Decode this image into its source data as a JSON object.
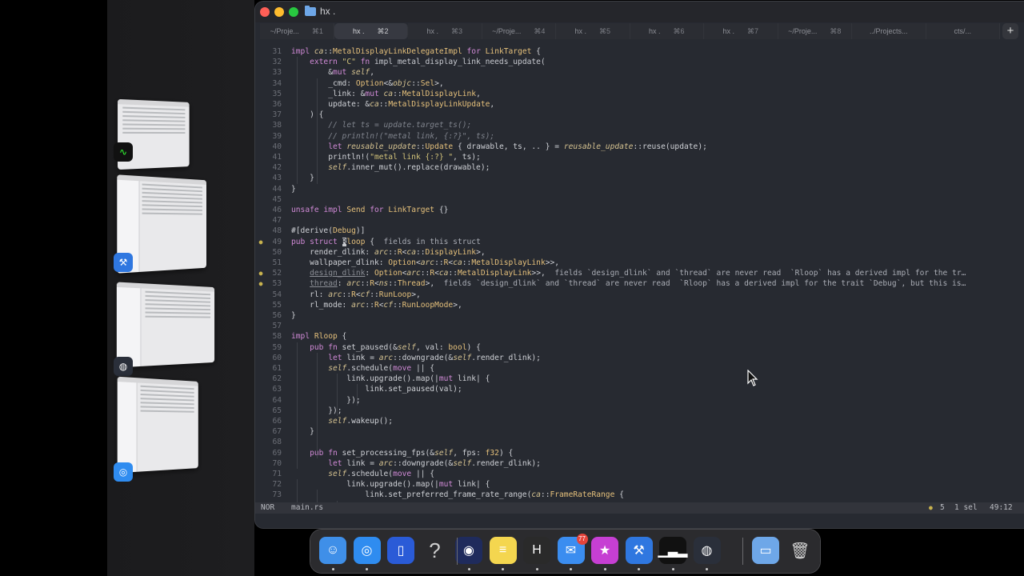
{
  "window": {
    "title": "hx ."
  },
  "tabs": [
    {
      "label": "~/Proje...",
      "shortcut": "⌘1"
    },
    {
      "label": "hx .",
      "shortcut": "⌘2",
      "active": true
    },
    {
      "label": "hx .",
      "shortcut": "⌘3"
    },
    {
      "label": "~/Proje...",
      "shortcut": "⌘4"
    },
    {
      "label": "hx .",
      "shortcut": "⌘5"
    },
    {
      "label": "hx .",
      "shortcut": "⌘6"
    },
    {
      "label": "hx .",
      "shortcut": "⌘7"
    },
    {
      "label": "~/Proje...",
      "shortcut": "⌘8"
    },
    {
      "label": "../Projects...",
      "shortcut": ""
    },
    {
      "label": "cts/...",
      "shortcut": ""
    }
  ],
  "new_tab_label": "+",
  "editor": {
    "lines": [
      {
        "n": "31",
        "parts": [
          [
            "kw",
            "impl "
          ],
          [
            "ns",
            "ca"
          ],
          [
            "",
            "::"
          ],
          [
            "ty",
            "MetalDisplayLinkDelegateImpl"
          ],
          [
            "kw",
            " for "
          ],
          [
            "ty",
            "LinkTarget"
          ],
          [
            "",
            " {"
          ]
        ]
      },
      {
        "n": "32",
        "parts": [
          [
            "",
            "    "
          ],
          [
            "kw",
            "extern "
          ],
          [
            "str",
            "\"C\" "
          ],
          [
            "kw",
            "fn "
          ],
          [
            "fn",
            "impl_metal_display_link_needs_update("
          ]
        ]
      },
      {
        "n": "33",
        "parts": [
          [
            "",
            "        &"
          ],
          [
            "kw",
            "mut "
          ],
          [
            "ns",
            "self"
          ],
          [
            "",
            ","
          ]
        ]
      },
      {
        "n": "34",
        "parts": [
          [
            "",
            "        _cmd: "
          ],
          [
            "ty",
            "Option"
          ],
          [
            "",
            "<&"
          ],
          [
            "ns",
            "objc"
          ],
          [
            "",
            "::"
          ],
          [
            "ty",
            "Sel"
          ],
          [
            "",
            ">,"
          ]
        ]
      },
      {
        "n": "35",
        "parts": [
          [
            "",
            "        _link: &"
          ],
          [
            "kw",
            "mut "
          ],
          [
            "ns",
            "ca"
          ],
          [
            "",
            "::"
          ],
          [
            "ty",
            "MetalDisplayLink"
          ],
          [
            "",
            ","
          ]
        ]
      },
      {
        "n": "36",
        "parts": [
          [
            "",
            "        update: &"
          ],
          [
            "ns",
            "ca"
          ],
          [
            "",
            "::"
          ],
          [
            "ty",
            "MetalDisplayLinkUpdate"
          ],
          [
            "",
            ","
          ]
        ]
      },
      {
        "n": "37",
        "parts": [
          [
            "",
            "    ) {"
          ]
        ]
      },
      {
        "n": "38",
        "parts": [
          [
            "",
            "        "
          ],
          [
            "cm",
            "// let ts = update.target_ts();"
          ]
        ]
      },
      {
        "n": "39",
        "parts": [
          [
            "",
            "        "
          ],
          [
            "cm",
            "// println!(\"metal link, {:?}\", ts);"
          ]
        ]
      },
      {
        "n": "40",
        "parts": [
          [
            "",
            "        "
          ],
          [
            "kw",
            "let "
          ],
          [
            "ns",
            "reusable_update"
          ],
          [
            "",
            "::"
          ],
          [
            "ty",
            "Update"
          ],
          [
            "",
            " { drawable, ts, .. } = "
          ],
          [
            "ns",
            "reusable_update"
          ],
          [
            "",
            "::reuse(update);"
          ]
        ]
      },
      {
        "n": "41",
        "parts": [
          [
            "",
            "        println!("
          ],
          [
            "str",
            "\"metal link {:?} \""
          ],
          [
            "",
            ", ts);"
          ]
        ]
      },
      {
        "n": "42",
        "parts": [
          [
            "",
            "        "
          ],
          [
            "ns",
            "self"
          ],
          [
            "",
            ".inner_mut().replace(drawable);"
          ]
        ]
      },
      {
        "n": "43",
        "parts": [
          [
            "",
            "    }"
          ]
        ]
      },
      {
        "n": "44",
        "parts": [
          [
            "",
            "}"
          ]
        ]
      },
      {
        "n": "45",
        "parts": [
          [
            "",
            ""
          ]
        ]
      },
      {
        "n": "46",
        "parts": [
          [
            "kw",
            "unsafe impl "
          ],
          [
            "ty",
            "Send"
          ],
          [
            "kw",
            " for "
          ],
          [
            "ty",
            "LinkTarget"
          ],
          [
            "",
            " {}"
          ]
        ]
      },
      {
        "n": "47",
        "parts": [
          [
            "",
            ""
          ]
        ]
      },
      {
        "n": "48",
        "parts": [
          [
            "",
            "#[derive("
          ],
          [
            "ty",
            "Debug"
          ],
          [
            "",
            ")]"
          ]
        ]
      },
      {
        "n": "49",
        "gutter": "●",
        "parts": [
          [
            "kw",
            "pub struct "
          ],
          [
            "cur",
            "R"
          ],
          [
            "ty",
            "loop"
          ],
          [
            "",
            " {  "
          ],
          [
            "hint",
            "fields in this struct"
          ]
        ]
      },
      {
        "n": "50",
        "parts": [
          [
            "",
            "    render_dlink: "
          ],
          [
            "ns",
            "arc"
          ],
          [
            "",
            "::"
          ],
          [
            "ty",
            "R"
          ],
          [
            "",
            "<"
          ],
          [
            "ns",
            "ca"
          ],
          [
            "",
            "::"
          ],
          [
            "ty",
            "DisplayLink"
          ],
          [
            "",
            ">,"
          ]
        ]
      },
      {
        "n": "51",
        "parts": [
          [
            "",
            "    wallpaper_dlink: "
          ],
          [
            "ty",
            "Option"
          ],
          [
            "",
            "<"
          ],
          [
            "ns",
            "arc"
          ],
          [
            "",
            "::"
          ],
          [
            "ty",
            "R"
          ],
          [
            "",
            "<"
          ],
          [
            "ns",
            "ca"
          ],
          [
            "",
            "::"
          ],
          [
            "ty",
            "MetalDisplayLink"
          ],
          [
            "",
            ">>,"
          ]
        ]
      },
      {
        "n": "52",
        "gutter": "●",
        "parts": [
          [
            "",
            "    "
          ],
          [
            "dim",
            "design_dlink"
          ],
          [
            "",
            ": "
          ],
          [
            "ty",
            "Option"
          ],
          [
            "",
            "<"
          ],
          [
            "ns",
            "arc"
          ],
          [
            "",
            "::"
          ],
          [
            "ty",
            "R"
          ],
          [
            "",
            "<"
          ],
          [
            "ns",
            "ca"
          ],
          [
            "",
            "::"
          ],
          [
            "ty",
            "MetalDisplayLink"
          ],
          [
            "",
            ">>,  "
          ],
          [
            "hint",
            "fields `design_dlink` and `thread` are never read  `Rloop` has a derived impl for the tr…"
          ]
        ]
      },
      {
        "n": "53",
        "gutter": "●",
        "parts": [
          [
            "",
            "    "
          ],
          [
            "dim",
            "thread"
          ],
          [
            "",
            ": "
          ],
          [
            "ns",
            "arc"
          ],
          [
            "",
            "::"
          ],
          [
            "ty",
            "R"
          ],
          [
            "",
            "<"
          ],
          [
            "ns",
            "ns"
          ],
          [
            "",
            "::"
          ],
          [
            "ty",
            "Thread"
          ],
          [
            "",
            ">,  "
          ],
          [
            "hint",
            "fields `design_dlink` and `thread` are never read  `Rloop` has a derived impl for the trait `Debug`, but this is…"
          ]
        ]
      },
      {
        "n": "54",
        "parts": [
          [
            "",
            "    rl: "
          ],
          [
            "ns",
            "arc"
          ],
          [
            "",
            "::"
          ],
          [
            "ty",
            "R"
          ],
          [
            "",
            "<"
          ],
          [
            "ns",
            "cf"
          ],
          [
            "",
            "::"
          ],
          [
            "ty",
            "RunLoop"
          ],
          [
            "",
            ">,"
          ]
        ]
      },
      {
        "n": "55",
        "parts": [
          [
            "",
            "    rl_mode: "
          ],
          [
            "ns",
            "arc"
          ],
          [
            "",
            "::"
          ],
          [
            "ty",
            "R"
          ],
          [
            "",
            "<"
          ],
          [
            "ns",
            "cf"
          ],
          [
            "",
            "::"
          ],
          [
            "ty",
            "RunLoopMode"
          ],
          [
            "",
            ">,"
          ]
        ]
      },
      {
        "n": "56",
        "parts": [
          [
            "",
            "}"
          ]
        ]
      },
      {
        "n": "57",
        "parts": [
          [
            "",
            ""
          ]
        ]
      },
      {
        "n": "58",
        "parts": [
          [
            "kw",
            "impl "
          ],
          [
            "ty",
            "Rloop"
          ],
          [
            "",
            " {"
          ]
        ]
      },
      {
        "n": "59",
        "parts": [
          [
            "",
            "    "
          ],
          [
            "kw",
            "pub fn "
          ],
          [
            "",
            "set_paused(&"
          ],
          [
            "ns",
            "self"
          ],
          [
            "",
            ", val: "
          ],
          [
            "ty",
            "bool"
          ],
          [
            "",
            ") {"
          ]
        ]
      },
      {
        "n": "60",
        "parts": [
          [
            "",
            "        "
          ],
          [
            "kw",
            "let "
          ],
          [
            "",
            "link = "
          ],
          [
            "ns",
            "arc"
          ],
          [
            "",
            "::downgrade(&"
          ],
          [
            "ns",
            "self"
          ],
          [
            "",
            ".render_dlink);"
          ]
        ]
      },
      {
        "n": "61",
        "parts": [
          [
            "",
            "        "
          ],
          [
            "ns",
            "self"
          ],
          [
            "",
            ".schedule("
          ],
          [
            "kw",
            "move"
          ],
          [
            "",
            " || {"
          ]
        ]
      },
      {
        "n": "62",
        "parts": [
          [
            "",
            "            link.upgrade().map(|"
          ],
          [
            "kw",
            "mut "
          ],
          [
            "",
            "link| {"
          ]
        ]
      },
      {
        "n": "63",
        "parts": [
          [
            "",
            "                link.set_paused(val);"
          ]
        ]
      },
      {
        "n": "64",
        "parts": [
          [
            "",
            "            });"
          ]
        ]
      },
      {
        "n": "65",
        "parts": [
          [
            "",
            "        });"
          ]
        ]
      },
      {
        "n": "66",
        "parts": [
          [
            "",
            "        "
          ],
          [
            "ns",
            "self"
          ],
          [
            "",
            ".wakeup();"
          ]
        ]
      },
      {
        "n": "67",
        "parts": [
          [
            "",
            "    }"
          ]
        ]
      },
      {
        "n": "68",
        "parts": [
          [
            "",
            ""
          ]
        ]
      },
      {
        "n": "69",
        "parts": [
          [
            "",
            "    "
          ],
          [
            "kw",
            "pub fn "
          ],
          [
            "",
            "set_processing_fps(&"
          ],
          [
            "ns",
            "self"
          ],
          [
            "",
            ", fps: "
          ],
          [
            "ty",
            "f32"
          ],
          [
            "",
            ") {"
          ]
        ]
      },
      {
        "n": "70",
        "parts": [
          [
            "",
            "        "
          ],
          [
            "kw",
            "let "
          ],
          [
            "",
            "link = "
          ],
          [
            "ns",
            "arc"
          ],
          [
            "",
            "::downgrade(&"
          ],
          [
            "ns",
            "self"
          ],
          [
            "",
            ".render_dlink);"
          ]
        ]
      },
      {
        "n": "71",
        "parts": [
          [
            "",
            "        "
          ],
          [
            "ns",
            "self"
          ],
          [
            "",
            ".schedule("
          ],
          [
            "kw",
            "move"
          ],
          [
            "",
            " || {"
          ]
        ]
      },
      {
        "n": "72",
        "parts": [
          [
            "",
            "            link.upgrade().map(|"
          ],
          [
            "kw",
            "mut "
          ],
          [
            "",
            "link| {"
          ]
        ]
      },
      {
        "n": "73",
        "parts": [
          [
            "",
            "                link.set_preferred_frame_rate_range("
          ],
          [
            "ns",
            "ca"
          ],
          [
            "",
            "::"
          ],
          [
            "ty",
            "FrameRateRange"
          ],
          [
            "",
            " {"
          ]
        ]
      }
    ]
  },
  "status": {
    "mode": "NOR",
    "file": "main.rs",
    "diagnostics_icon": "●",
    "diagnostics": "5",
    "selection": "1 sel",
    "position": "49:12",
    "diag_color": "#c9b34e"
  },
  "dock": {
    "apps": [
      {
        "name": "Finder",
        "icon": "finder-icon",
        "glyph": "☺",
        "color": "#3f8fe8",
        "running": true
      },
      {
        "name": "Safari",
        "icon": "safari-icon",
        "glyph": "◎",
        "color": "#2f8cf0",
        "running": true
      },
      {
        "name": "Simulator",
        "icon": "simulator-icon",
        "glyph": "▯",
        "color": "#2a5bd7",
        "running": false
      },
      {
        "name": "Help",
        "icon": "question-icon",
        "glyph": "?",
        "color": "transparent",
        "running": false
      },
      {
        "name": "Ghostty",
        "icon": "ghostty-icon",
        "glyph": "◉",
        "color": "#1f2b5c",
        "running": true
      },
      {
        "name": "Notes",
        "icon": "notes-icon",
        "glyph": "≡",
        "color": "#f4d64f",
        "running": true
      },
      {
        "name": "Helix",
        "icon": "helix-icon",
        "glyph": "H",
        "color": "#2a2a2a",
        "running": true
      },
      {
        "name": "Mail",
        "icon": "mail-icon",
        "glyph": "✉",
        "color": "#3b8df0",
        "running": true,
        "badge": "77"
      },
      {
        "name": "Reeder",
        "icon": "star-icon",
        "glyph": "★",
        "color": "#c63fd3",
        "running": true
      },
      {
        "name": "Xcode",
        "icon": "xcode-icon",
        "glyph": "⚒",
        "color": "#2f77e0",
        "running": true
      },
      {
        "name": "Activity Monitor",
        "icon": "activity-monitor-icon",
        "glyph": "▁▃▂",
        "color": "#111",
        "running": true
      },
      {
        "name": "Instruments",
        "icon": "instruments-icon",
        "glyph": "◍",
        "color": "#2a2f3a",
        "running": true
      }
    ],
    "others": [
      {
        "name": "Downloads",
        "icon": "folder-icon",
        "glyph": "▭",
        "color": "#6ea7e8"
      },
      {
        "name": "Trash",
        "icon": "trash-icon",
        "glyph": "🗑",
        "color": "transparent"
      }
    ]
  }
}
